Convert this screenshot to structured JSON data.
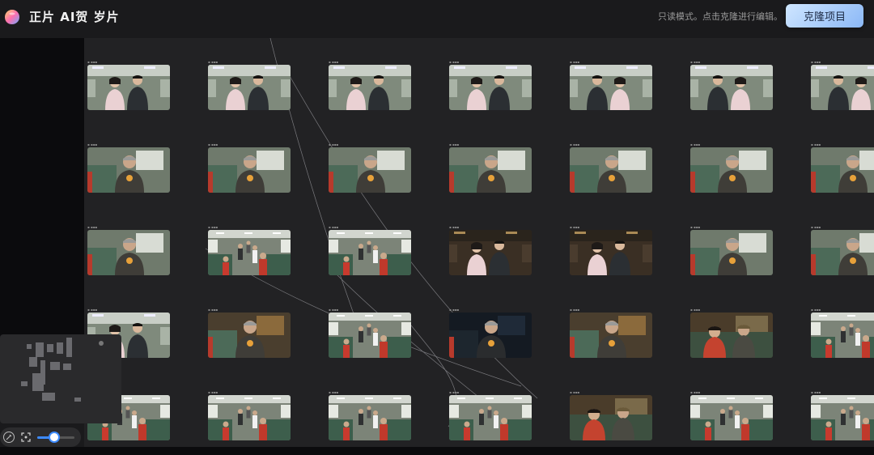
{
  "header": {
    "app_title": "正片 AI贺 岁片",
    "readonly_notice": "只读模式。点击克隆进行编辑。",
    "clone_button": "克隆项目"
  },
  "colors": {
    "accent": "#3d8bff",
    "clone_button_gradient": [
      "#cfe6ff",
      "#8bb8f6"
    ],
    "canvas_bg": "#222224",
    "left_panel_bg": "#0b0b0d"
  },
  "zoom": {
    "level": 0.45
  },
  "grid": {
    "columns": 7,
    "rows": [
      {
        "scene": "couple",
        "variants": [
          0,
          0,
          0,
          0,
          1,
          1,
          1
        ]
      },
      {
        "scene": "oldman",
        "variants": [
          0,
          0,
          0,
          0,
          0,
          0,
          0
        ]
      },
      {
        "scene": "mixed",
        "variants": [
          "oldman",
          "aisle",
          "aisle",
          "couple-dark",
          "couple-dark",
          "oldman",
          "oldman"
        ]
      },
      {
        "scene": "mixed",
        "variants": [
          "couple",
          "oldman-warm",
          "aisle",
          "oldman-dark",
          "oldman-warm",
          "pair-warm",
          "aisle"
        ]
      },
      {
        "scene": "mixed",
        "variants": [
          "aisle",
          "aisle",
          "aisle",
          "aisle",
          "pair-warm",
          "aisle",
          "aisle"
        ]
      }
    ]
  }
}
